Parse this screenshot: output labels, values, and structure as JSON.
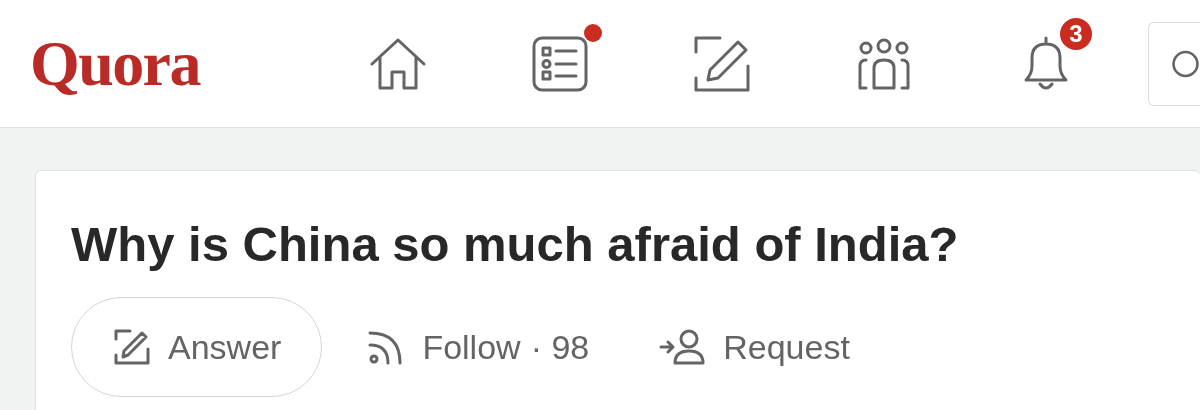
{
  "header": {
    "logo": "Quora",
    "nav": [
      {
        "kind": "home",
        "dot": false
      },
      {
        "kind": "following",
        "dot": true
      },
      {
        "kind": "answer",
        "dot": false
      },
      {
        "kind": "spaces",
        "dot": false
      },
      {
        "kind": "notifications",
        "dot": false,
        "badge": "3"
      }
    ]
  },
  "question": {
    "title": "Why is China so much afraid of India?",
    "actions": [
      {
        "kind": "answer",
        "label": "Answer"
      },
      {
        "kind": "follow",
        "label": "Follow",
        "count": "· 98"
      },
      {
        "kind": "request",
        "label": "Request"
      }
    ]
  }
}
